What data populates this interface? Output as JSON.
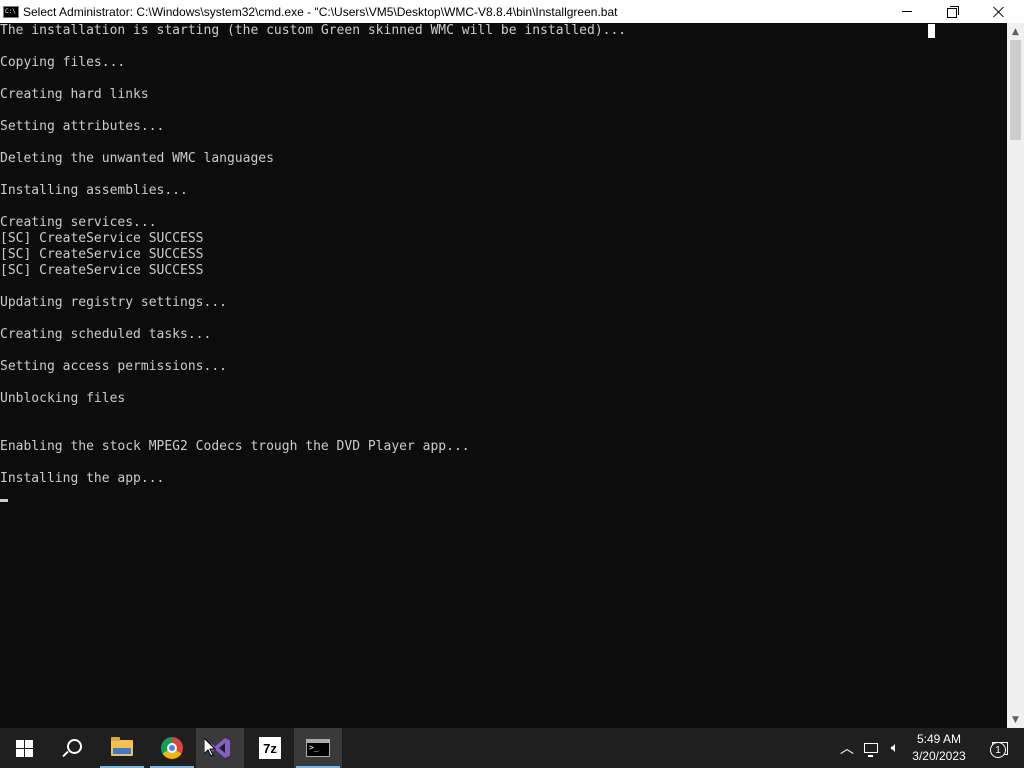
{
  "window": {
    "title": "Select Administrator: C:\\Windows\\system32\\cmd.exe - \"C:\\Users\\VM5\\Desktop\\WMC-V8.8.4\\bin\\Installgreen.bat"
  },
  "console": {
    "lines": [
      "The installation is starting (the custom Green skinned WMC will be installed)...",
      "",
      "Copying files...",
      "",
      "Creating hard links",
      "",
      "Setting attributes...",
      "",
      "Deleting the unwanted WMC languages",
      "",
      "Installing assemblies...",
      "",
      "Creating services...",
      "[SC] CreateService SUCCESS",
      "[SC] CreateService SUCCESS",
      "[SC] CreateService SUCCESS",
      "",
      "Updating registry settings...",
      "",
      "Creating scheduled tasks...",
      "",
      "Setting access permissions...",
      "",
      "Unblocking files",
      "",
      "",
      "Enabling the stock MPEG2 Codecs trough the DVD Player app...",
      "",
      "Installing the app..."
    ]
  },
  "taskbar": {
    "pinned": [
      {
        "name": "start-button",
        "icon": "windows-logo-icon"
      },
      {
        "name": "search-button",
        "icon": "search-icon"
      },
      {
        "name": "file-explorer",
        "icon": "folder-icon"
      },
      {
        "name": "chrome",
        "icon": "chrome-icon"
      },
      {
        "name": "visual-studio",
        "icon": "visual-studio-icon"
      },
      {
        "name": "7zip",
        "icon": "7zip-icon",
        "label": "7z"
      },
      {
        "name": "command-prompt",
        "icon": "cmd-icon"
      }
    ],
    "clock": {
      "time": "5:49 AM",
      "date": "3/20/2023"
    },
    "notification_count": "1"
  },
  "colors": {
    "console_bg": "#0c0c0c",
    "console_text": "#cccccc",
    "taskbar_bg": "#1f1f1f",
    "accent": "#76b9ed"
  }
}
